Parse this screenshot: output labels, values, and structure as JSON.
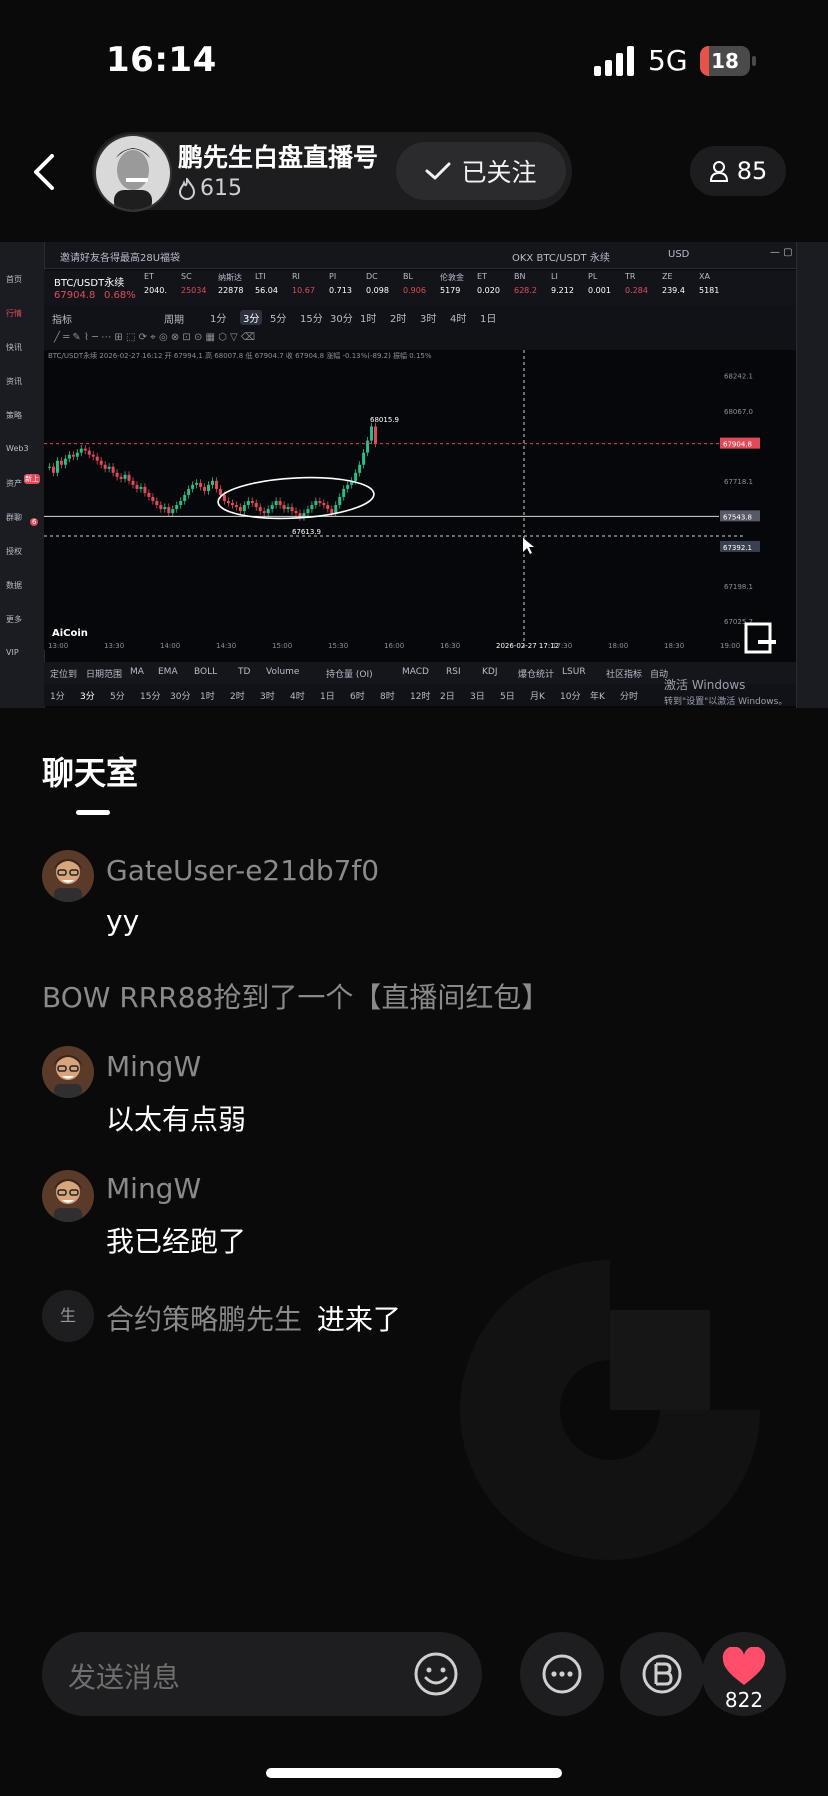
{
  "status_bar": {
    "time": "16:14",
    "network": "5G",
    "battery": "18",
    "battery_level": 0.18
  },
  "header": {
    "host_name": "鹏先生白盘直播号",
    "host_heat": "615",
    "follow_label": "已关注",
    "viewer_count": "85"
  },
  "stream": {
    "tab_label": "邀请好友各得最高28U福袋",
    "pair_search": "OKX BTC/USDT 永续",
    "currency": "USD",
    "pair": "BTC/USDT永续",
    "pair_price": "67904.8",
    "pair_change": "0.68%",
    "tickers": [
      {
        "sym": "ET",
        "val": "2040."
      },
      {
        "sym": "SC",
        "val": "25034"
      },
      {
        "sym": "纳斯达",
        "val": "22878"
      },
      {
        "sym": "LTI",
        "val": "56.04"
      },
      {
        "sym": "RI",
        "val": "10.67"
      },
      {
        "sym": "PI",
        "val": "0.713"
      },
      {
        "sym": "DC",
        "val": "0.098"
      },
      {
        "sym": "BL",
        "val": "0.906"
      },
      {
        "sym": "伦敦金",
        "val": "5179"
      },
      {
        "sym": "ET",
        "val": "0.020"
      },
      {
        "sym": "BN",
        "val": "628.2"
      },
      {
        "sym": "LI",
        "val": "9.212"
      },
      {
        "sym": "PL",
        "val": "0.001"
      },
      {
        "sym": "TR",
        "val": "0.284"
      },
      {
        "sym": "ZE",
        "val": "239.4"
      },
      {
        "sym": "XA",
        "val": "5181"
      }
    ],
    "timeframes": [
      "1分",
      "3分",
      "5分",
      "15分",
      "30分",
      "1时",
      "2时",
      "3时",
      "4时",
      "1日"
    ],
    "indicator_label": "指标",
    "period_label": "周期",
    "ohlc_line": "BTC/USDT永续 2026-02-27 16:12 开 67994.1 高 68007.8 低 67904.7 收 67904.8 涨幅 -0.13%(-89.2) 振幅 0.15%",
    "price_axis": [
      "68242.1",
      "68067.0",
      "67904.8",
      "67718.1",
      "67543.8",
      "67392.1",
      "67198.1",
      "67025.7"
    ],
    "current_price_tag": "67904.8",
    "level_tag": "67543.8",
    "cursor_tag": "67392.1",
    "high_label": "68015.9",
    "low_label": "67613.9",
    "logo": "AiCoin",
    "time_axis": [
      "13:00",
      "13:30",
      "14:00",
      "14:30",
      "15:00",
      "15:30",
      "16:00",
      "16:30",
      "2026-02-27 17:12",
      "17:30",
      "18:00",
      "18:30",
      "19:00"
    ],
    "bottom_tabs": [
      "定位到",
      "日期范围",
      "MA",
      "EMA",
      "BOLL",
      "TD",
      "Volume",
      "持仓量 (OI)",
      "MACD",
      "RSI",
      "KDJ",
      "爆仓统计",
      "LSUR",
      "社区指标",
      "自动"
    ],
    "bottom_timeframes": [
      "1分",
      "3分",
      "5分",
      "15分",
      "30分",
      "1时",
      "2时",
      "3时",
      "4时",
      "1日",
      "6时",
      "8时",
      "12时",
      "2日",
      "3日",
      "5日",
      "月K",
      "10分",
      "年K",
      "分时"
    ],
    "watermark_line1": "激活 Windows",
    "watermark_line2": "转到\"设置\"以激活 Windows。",
    "sidebar_labels": [
      "首页",
      "行情",
      "快讯",
      "资讯",
      "策略",
      "Web3",
      "资产",
      "群聊",
      "授权",
      "数据",
      "更多",
      "VIP"
    ],
    "sidebar_badge_new": "新上",
    "sidebar_badge_count": "6"
  },
  "chat": {
    "title": "聊天室",
    "messages": [
      {
        "user": "GateUser-e21db7f0",
        "text": "yy"
      },
      {
        "system": "BOW RRR88抢到了一个【直播间红包】"
      },
      {
        "user": "MingW",
        "text": "以太有点弱"
      },
      {
        "user": "MingW",
        "text": "我已经跑了"
      }
    ],
    "join_avatar": "生",
    "join_user": "合约策略鹏先生",
    "join_text": "进来了"
  },
  "bottom_bar": {
    "input_placeholder": "发送消息",
    "like_count": "822"
  },
  "colors": {
    "background": "#0a0a0a",
    "like": "#ff4d6a",
    "candle_up": "#2ebd85",
    "candle_down": "#e04b5a"
  }
}
